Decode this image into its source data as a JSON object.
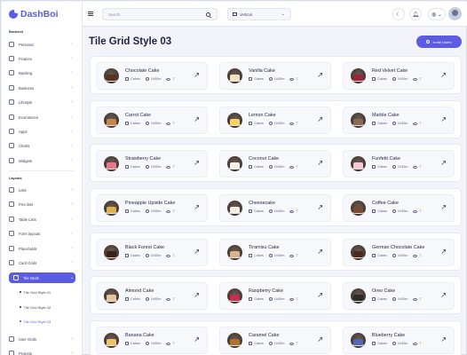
{
  "app": {
    "brand": "DashBoi"
  },
  "colors": {
    "accent": "#5b5ce2"
  },
  "topbar": {
    "search_placeholder": "Search",
    "layout_select": "Vertical",
    "icons": [
      "menu-icon",
      "search-icon",
      "moon-icon",
      "bell-icon",
      "globe-icon",
      "avatar"
    ]
  },
  "sidebar": {
    "sections": [
      {
        "title": "Backend",
        "items": [
          "Personal",
          "Finance",
          "Banking",
          "Business",
          "Lifestyle",
          "Ecommerce",
          "Apps",
          "Charts",
          "Widgets"
        ]
      },
      {
        "title": "Layouts",
        "items": [
          "Lists",
          "Flex lists",
          "Table Lists",
          "Form layouts",
          "Placeholds",
          "Card Grids",
          "Tile Grids"
        ]
      }
    ],
    "active_item": "Tile Grids",
    "sub_items": [
      "Tile Grid Style 01",
      "Tile Grid Style 02",
      "Tile Grid Style 03"
    ],
    "current_sub": "Tile Grid Style 03",
    "after_items": [
      "User Grids",
      "Projects"
    ]
  },
  "main": {
    "page_title": "Tile Grid Style 03",
    "invite_button": "Invite Users",
    "rows": [
      [
        {
          "name": "Chocolate Cake",
          "cat": "Cakes",
          "time": "1h30m",
          "n": "7"
        },
        {
          "name": "Vanilla Cake",
          "cat": "Cakes",
          "time": "1h30m",
          "n": "7"
        },
        {
          "name": "Red Velvet Cake",
          "cat": "Cakes",
          "time": "1h30m",
          "n": "7"
        }
      ],
      [
        {
          "name": "Carrot Cake",
          "cat": "Cakes",
          "time": "1h30m",
          "n": "7"
        },
        {
          "name": "Lemon Cake",
          "cat": "Cakes",
          "time": "1h30m",
          "n": "7"
        },
        {
          "name": "Marble Cake",
          "cat": "Cakes",
          "time": "1h30m",
          "n": "7"
        }
      ],
      [
        {
          "name": "Strawberry Cake",
          "cat": "Cakes",
          "time": "1h30m",
          "n": "7"
        },
        {
          "name": "Coconut Cake",
          "cat": "Cakes",
          "time": "1h30m",
          "n": "7"
        },
        {
          "name": "Funfetti Cake",
          "cat": "Cakes",
          "time": "1h30m",
          "n": "7"
        }
      ],
      [
        {
          "name": "Pineapple Upside Cake",
          "cat": "Cakes",
          "time": "1h30m",
          "n": "7"
        },
        {
          "name": "Cheesecake",
          "cat": "Cakes",
          "time": "1h30m",
          "n": "7"
        },
        {
          "name": "Coffee Cake",
          "cat": "Cakes",
          "time": "1h30m",
          "n": "7"
        }
      ],
      [
        {
          "name": "Black Forest Cake",
          "cat": "Cakes",
          "time": "1h30m",
          "n": "7"
        },
        {
          "name": "Tiramisu Cake",
          "cat": "Cakes",
          "time": "1h30m",
          "n": "7"
        },
        {
          "name": "German Chocolate Cake",
          "cat": "Cakes",
          "time": "1h30m",
          "n": "7"
        }
      ],
      [
        {
          "name": "Almond Cake",
          "cat": "Cakes",
          "time": "1h30m",
          "n": "7"
        },
        {
          "name": "Raspberry Cake",
          "cat": "Cakes",
          "time": "1h30m",
          "n": "7"
        },
        {
          "name": "Oreo Cake",
          "cat": "Cakes",
          "time": "1h30m",
          "n": "7"
        }
      ],
      [
        {
          "name": "Banana Cake",
          "cat": "Cakes",
          "time": "1h30m",
          "n": "7"
        },
        {
          "name": "Caramel Cake",
          "cat": "Cakes",
          "time": "1h30m",
          "n": "7"
        },
        {
          "name": "Blueberry Cake",
          "cat": "Cakes",
          "time": "1h30m",
          "n": "7"
        }
      ]
    ]
  }
}
